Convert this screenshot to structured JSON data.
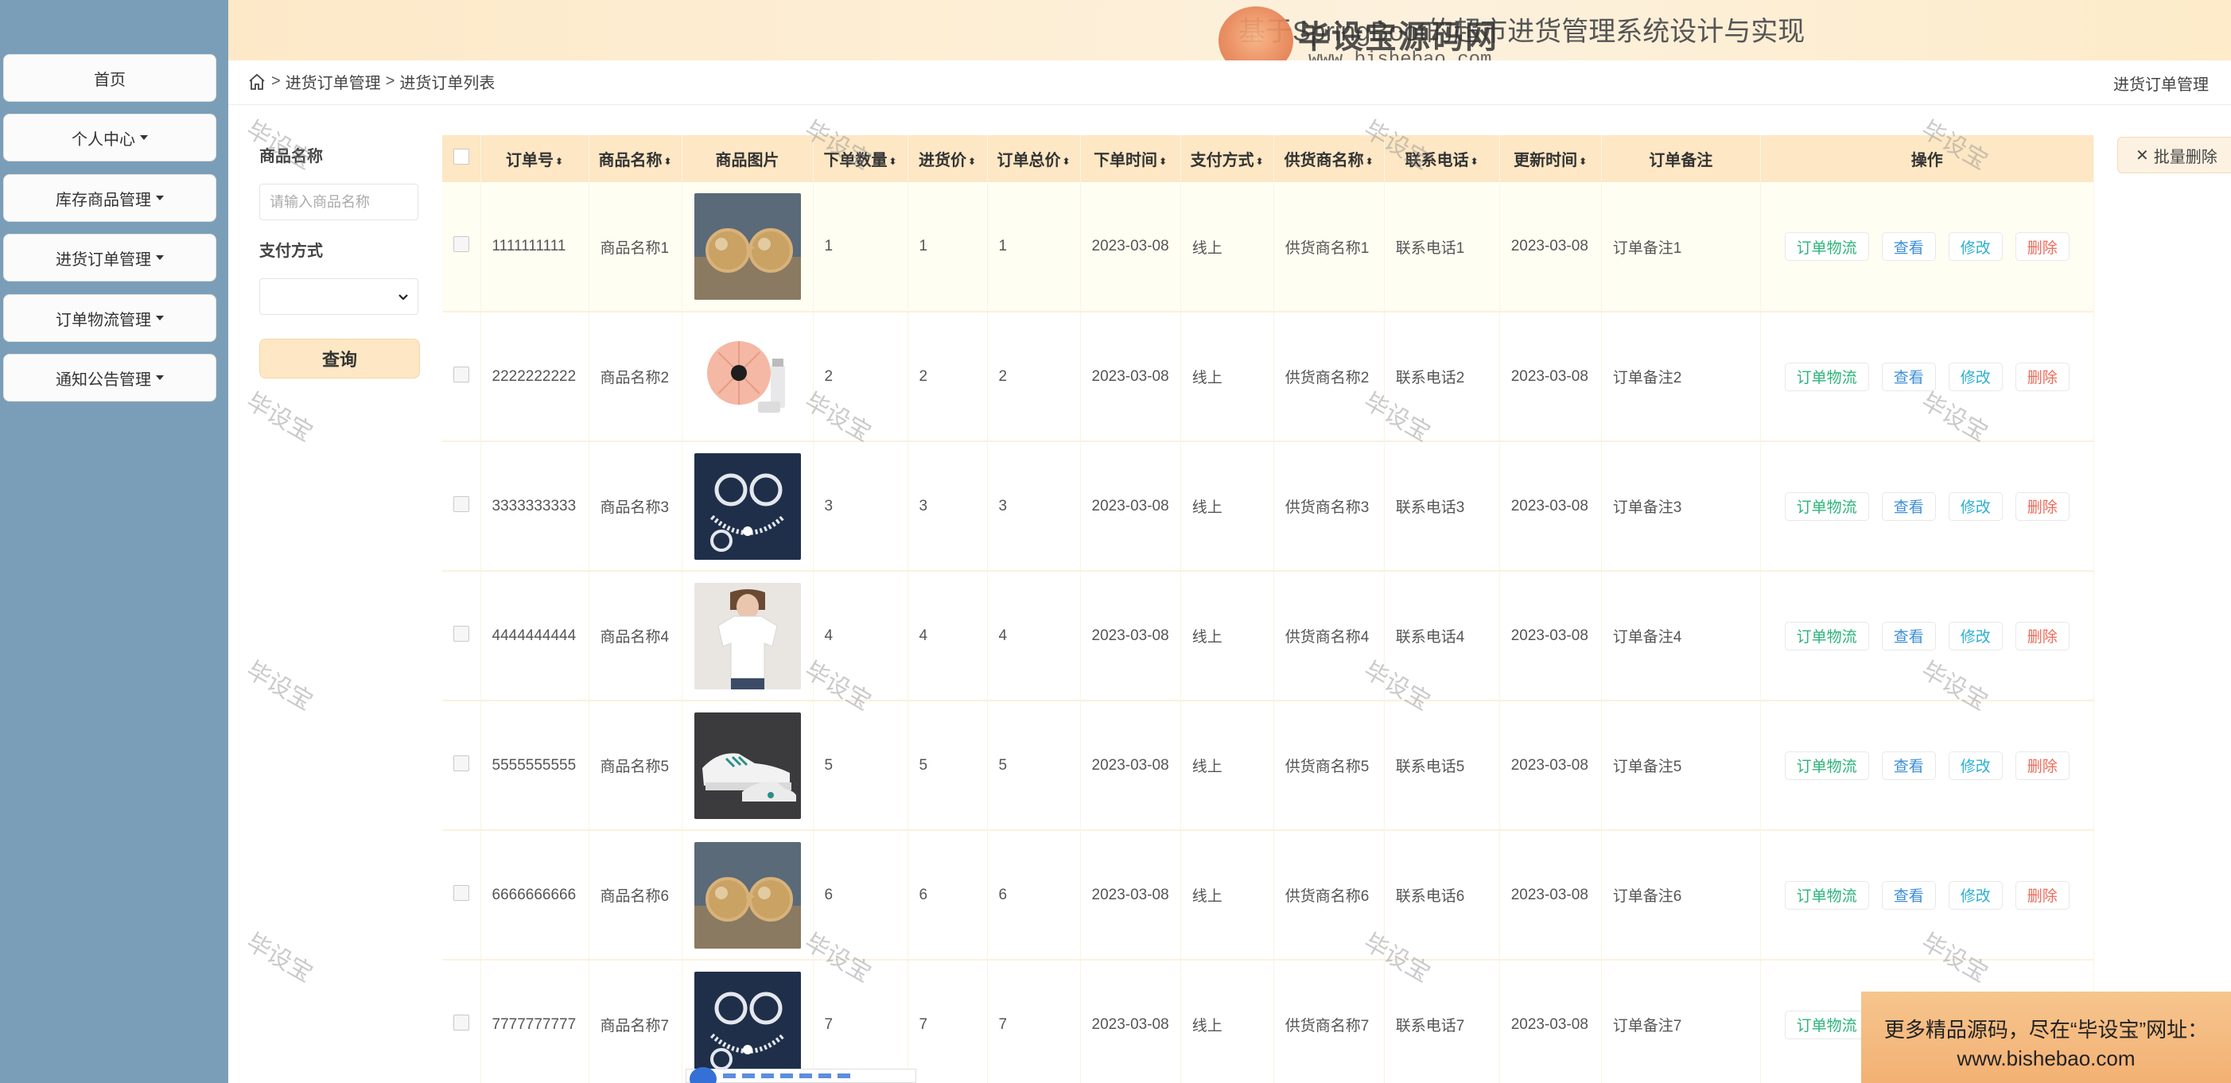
{
  "header": {
    "title": "基于SpringBoot的超市进货管理系统设计与实现",
    "brand_text": "毕设宝源码网",
    "brand_url": "www.bishebao.com"
  },
  "sidebar": {
    "items": [
      {
        "label": "首页",
        "has_caret": false
      },
      {
        "label": "个人中心",
        "has_caret": true
      },
      {
        "label": "库存商品管理",
        "has_caret": true
      },
      {
        "label": "进货订单管理",
        "has_caret": true
      },
      {
        "label": "订单物流管理",
        "has_caret": true
      },
      {
        "label": "通知公告管理",
        "has_caret": true
      }
    ]
  },
  "breadcrumb": {
    "level1": "进货订单管理",
    "level2": "进货订单列表",
    "right": "进货订单管理"
  },
  "search": {
    "name_label": "商品名称",
    "name_placeholder": "请输入商品名称",
    "pay_label": "支付方式",
    "query_button": "查询"
  },
  "batch_delete": "批量删除",
  "table": {
    "columns": [
      "订单号",
      "商品名称",
      "商品图片",
      "下单数量",
      "进货价",
      "订单总价",
      "下单时间",
      "支付方式",
      "供货商名称",
      "联系电话",
      "更新时间",
      "订单备注",
      "操作"
    ],
    "actions": [
      "订单物流",
      "查看",
      "修改",
      "删除"
    ],
    "rows": [
      {
        "order_no": "1111111111",
        "product": "商品名称1",
        "image": "sunglasses",
        "qty": "1",
        "price": "1",
        "total": "1",
        "order_time": "2023-03-08",
        "pay": "线上",
        "supplier": "供货商名称1",
        "phone": "联系电话1",
        "updated": "2023-03-08",
        "remark": "订单备注1"
      },
      {
        "order_no": "2222222222",
        "product": "商品名称2",
        "image": "cosmetics",
        "qty": "2",
        "price": "2",
        "total": "2",
        "order_time": "2023-03-08",
        "pay": "线上",
        "supplier": "供货商名称2",
        "phone": "联系电话2",
        "updated": "2023-03-08",
        "remark": "订单备注2"
      },
      {
        "order_no": "3333333333",
        "product": "商品名称3",
        "image": "jewelry",
        "qty": "3",
        "price": "3",
        "total": "3",
        "order_time": "2023-03-08",
        "pay": "线上",
        "supplier": "供货商名称3",
        "phone": "联系电话3",
        "updated": "2023-03-08",
        "remark": "订单备注3"
      },
      {
        "order_no": "4444444444",
        "product": "商品名称4",
        "image": "tshirt",
        "qty": "4",
        "price": "4",
        "total": "4",
        "order_time": "2023-03-08",
        "pay": "线上",
        "supplier": "供货商名称4",
        "phone": "联系电话4",
        "updated": "2023-03-08",
        "remark": "订单备注4"
      },
      {
        "order_no": "5555555555",
        "product": "商品名称5",
        "image": "sneaker",
        "qty": "5",
        "price": "5",
        "total": "5",
        "order_time": "2023-03-08",
        "pay": "线上",
        "supplier": "供货商名称5",
        "phone": "联系电话5",
        "updated": "2023-03-08",
        "remark": "订单备注5"
      },
      {
        "order_no": "6666666666",
        "product": "商品名称6",
        "image": "sunglasses",
        "qty": "6",
        "price": "6",
        "total": "6",
        "order_time": "2023-03-08",
        "pay": "线上",
        "supplier": "供货商名称6",
        "phone": "联系电话6",
        "updated": "2023-03-08",
        "remark": "订单备注6"
      },
      {
        "order_no": "7777777777",
        "product": "商品名称7",
        "image": "jewelry",
        "qty": "7",
        "price": "7",
        "total": "7",
        "order_time": "2023-03-08",
        "pay": "线上",
        "supplier": "供货商名称7",
        "phone": "联系电话7",
        "updated": "2023-03-08",
        "remark": "订单备注7"
      }
    ]
  },
  "watermark": "毕设宝",
  "promo": {
    "line1": "更多精品源码，尽在“毕设宝”网址：",
    "line2": "www.bishebao.com"
  },
  "colors": {
    "sidebar_bg": "#7b9eb8",
    "header_bg": "#fde9c8",
    "table_head_bg": "#fde7c4",
    "action_logistics": "#2bb57a",
    "action_view": "#3c8ed8",
    "action_edit": "#2ab0d0",
    "action_delete": "#ee6a59"
  }
}
